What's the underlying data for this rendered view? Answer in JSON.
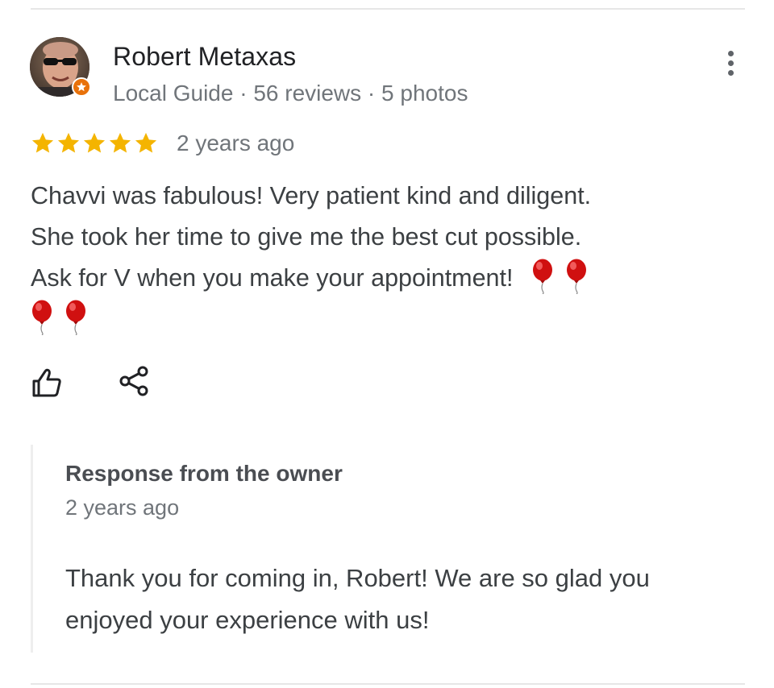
{
  "reviewer": {
    "name": "Robert Metaxas",
    "meta": "Local Guide · 56 reviews · 5 photos",
    "is_local_guide": true
  },
  "rating": {
    "stars": 5,
    "max_stars": 5,
    "star_color": "#f4b400",
    "date": "2 years ago"
  },
  "review": {
    "lines": [
      "Chavvi was fabulous! Very patient kind and diligent.",
      "She took her time to give me the best cut possible.",
      "Ask for V when you make your appointment!"
    ],
    "emoji": "🎈",
    "emoji_count": 4
  },
  "actions": {
    "like_icon": "thumbs-up-icon",
    "share_icon": "share-icon"
  },
  "owner_response": {
    "title": "Response from the owner",
    "date": "2 years ago",
    "lines": [
      "Thank you for coming in, Robert! We are so glad you",
      "enjoyed your experience with us!"
    ]
  },
  "colors": {
    "badge": "#e8710a",
    "balloon": "#d01010",
    "muted_text": "#70757a"
  }
}
